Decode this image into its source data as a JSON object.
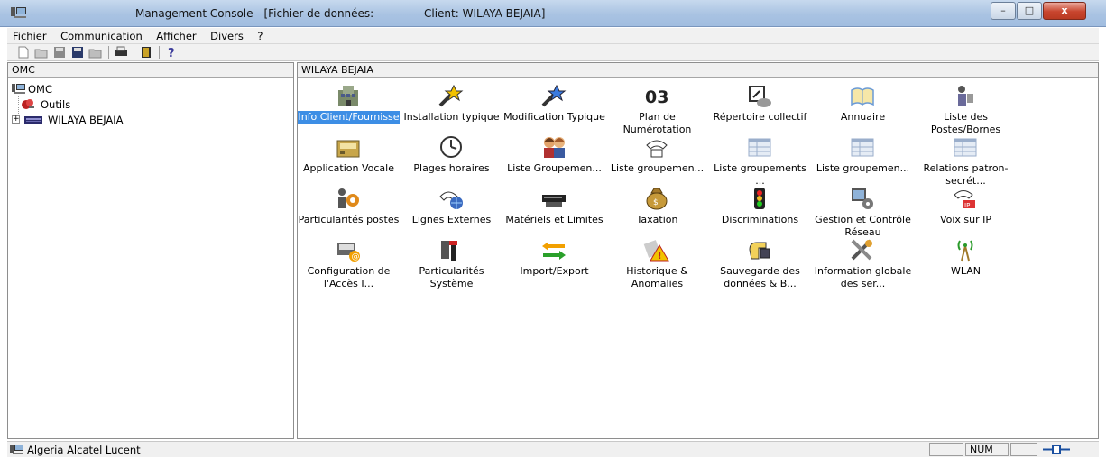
{
  "window": {
    "title": "Management Console - [Fichier de données:",
    "title_client": "Client: WILAYA BEJAIA]",
    "min_glyph": "–",
    "max_glyph": "□",
    "close_glyph": "x"
  },
  "menu": [
    "Fichier",
    "Communication",
    "Afficher",
    "Divers",
    "?"
  ],
  "toolbar": {
    "icons": [
      "new-icon",
      "open-icon",
      "save-icon",
      "save-as-icon",
      "open-folder-icon",
      "print-icon",
      "exit-door-icon",
      "help-icon"
    ]
  },
  "tree": {
    "header": "OMC",
    "root": "OMC",
    "children": [
      "Outils",
      "WILAYA BEJAIA"
    ],
    "expander": "+"
  },
  "content": {
    "header": "WILAYA BEJAIA",
    "items": [
      {
        "label": "Info Client/Fournisse",
        "icon": "building-icon",
        "selected": true
      },
      {
        "label": "Installation typique",
        "icon": "magic-wand-icon"
      },
      {
        "label": "Modification Typique",
        "icon": "magic-wand-blue-icon"
      },
      {
        "label": "Plan de Numérotation",
        "icon": "numbering-03-icon",
        "icon_text": "03"
      },
      {
        "label": "Répertoire collectif",
        "icon": "directory-phone-icon"
      },
      {
        "label": "Annuaire",
        "icon": "phonebook-icon"
      },
      {
        "label": "Liste des Postes/Bornes",
        "icon": "user-station-icon"
      },
      {
        "label": "Application Vocale",
        "icon": "voice-application-icon"
      },
      {
        "label": "Plages horaires",
        "icon": "clock-icon"
      },
      {
        "label": "Liste Groupemen...",
        "icon": "group-people-icon"
      },
      {
        "label": "Liste groupemen...",
        "icon": "group-phones-icon"
      },
      {
        "label": "Liste groupements ...",
        "icon": "list-table-icon"
      },
      {
        "label": "Liste groupemen...",
        "icon": "list-table-icon"
      },
      {
        "label": "Relations patron-secrét...",
        "icon": "list-table-icon"
      },
      {
        "label": "Particularités postes",
        "icon": "user-gear-icon"
      },
      {
        "label": "Lignes Externes",
        "icon": "external-lines-icon"
      },
      {
        "label": "Matériels et Limites",
        "icon": "hardware-icon"
      },
      {
        "label": "Taxation",
        "icon": "money-bag-icon"
      },
      {
        "label": "Discriminations",
        "icon": "traffic-light-icon"
      },
      {
        "label": "Gestion et Contrôle Réseau",
        "icon": "network-control-icon"
      },
      {
        "label": "Voix sur IP",
        "icon": "voip-icon"
      },
      {
        "label": "Configuration de l'Accès I...",
        "icon": "internet-access-icon",
        "icon_text": "@"
      },
      {
        "label": "Particularités Système",
        "icon": "system-tools-icon"
      },
      {
        "label": "Import/Export",
        "icon": "import-export-icon"
      },
      {
        "label": "Historique & Anomalies",
        "icon": "warning-history-icon",
        "icon_text": "!"
      },
      {
        "label": "Sauvegarde des données & B...",
        "icon": "backup-hand-icon"
      },
      {
        "label": "Information globale des ser...",
        "icon": "tools-info-icon"
      },
      {
        "label": "WLAN",
        "icon": "wlan-antenna-icon"
      }
    ]
  },
  "status": {
    "text": "Algeria Alcatel Lucent",
    "num": "NUM"
  },
  "colors": {
    "selection": "#3d8ee5",
    "titlebar": "#a9c3e2"
  }
}
